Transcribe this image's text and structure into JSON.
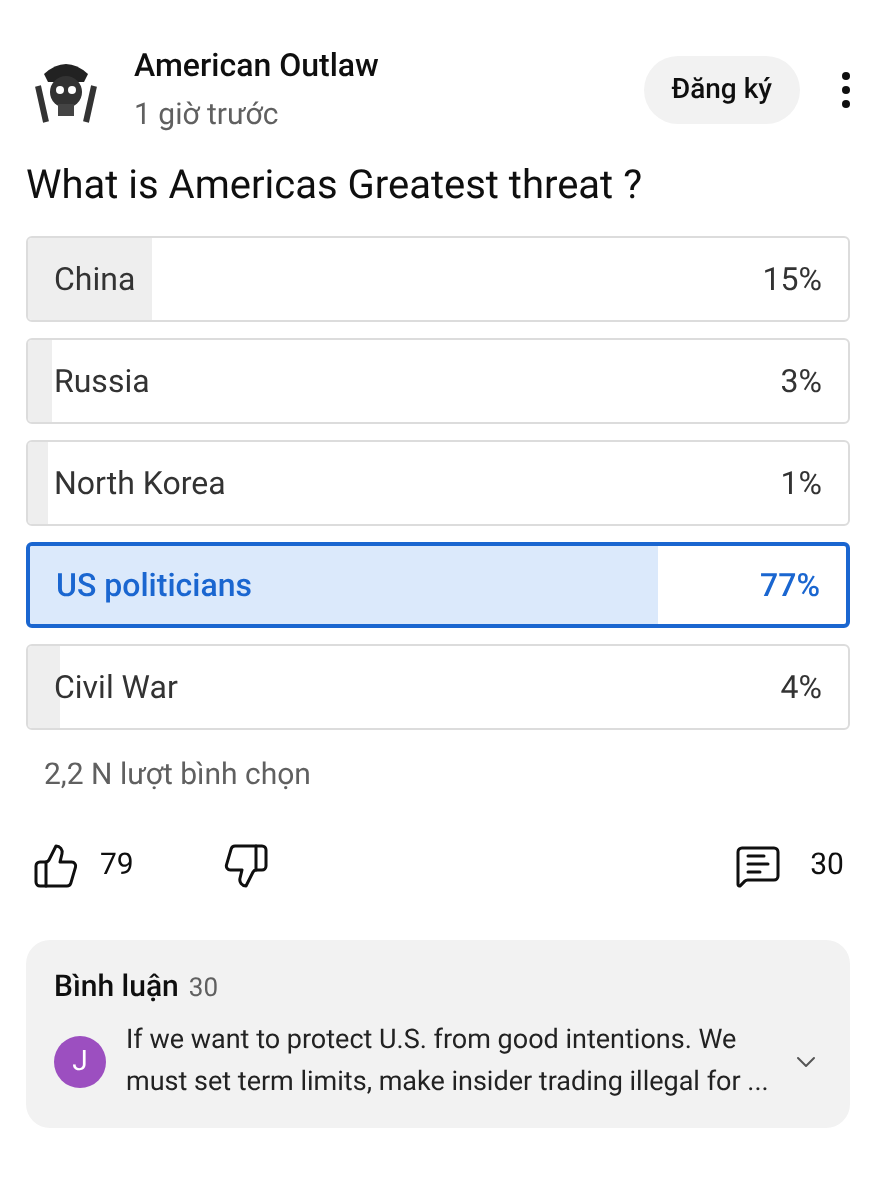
{
  "post": {
    "author": "American Outlaw",
    "time": "1 giờ trước",
    "subscribe": "Đăng ký",
    "question": "What is Americas Greatest threat ?"
  },
  "options": [
    {
      "label": "China",
      "percent": "15%",
      "level": 0.15,
      "selected": false
    },
    {
      "label": "Russia",
      "percent": "3%",
      "level": 0.03,
      "selected": false
    },
    {
      "label": "North Korea",
      "percent": "1%",
      "level": 0.01,
      "selected": false
    },
    {
      "label": "US politicians",
      "percent": "77%",
      "level": 0.77,
      "selected": true
    },
    {
      "label": "Civil War",
      "percent": "4%",
      "level": 0.04,
      "selected": false
    }
  ],
  "votes": "2,2 N lượt bình chọn",
  "actions": {
    "likes": "79",
    "comments": "30"
  },
  "comments": {
    "title": "Bình luận",
    "count": "30",
    "avatar_letter": "J",
    "text": "If we want to protect U.S. from good intentions. We must set term limits, make insider trading illegal for ..."
  }
}
